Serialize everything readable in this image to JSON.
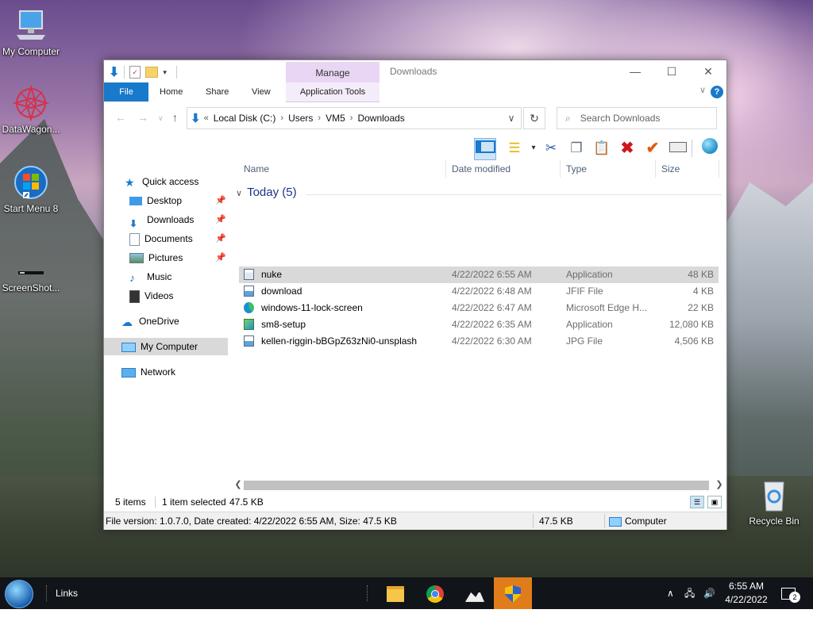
{
  "desktop": {
    "icons": [
      {
        "label": "My Computer",
        "icon": "computer-icon"
      },
      {
        "label": "DataWagon...",
        "icon": "datawagon-icon"
      },
      {
        "label": "Start Menu 8",
        "icon": "start-menu-icon"
      },
      {
        "label": "ScreenShot...",
        "icon": "screenshot-icon"
      },
      {
        "label": "Recycle Bin",
        "icon": "recycle-bin-icon"
      }
    ]
  },
  "window": {
    "title": "Downloads",
    "manage_label": "Manage",
    "controls": {
      "minimize": "—",
      "maximize": "☐",
      "close": "✕"
    },
    "ribbon_tabs": [
      "File",
      "Home",
      "Share",
      "View",
      "Application Tools"
    ],
    "help_glyph": "?",
    "address": {
      "prefix": "«",
      "segments": [
        "Local Disk (C:)",
        "Users",
        "VM5",
        "Downloads"
      ]
    },
    "search_placeholder": "Search Downloads",
    "nav_pane": {
      "quick_access": "Quick access",
      "pinned": [
        "Desktop",
        "Downloads",
        "Documents",
        "Pictures"
      ],
      "unpinned": [
        "Music",
        "Videos"
      ],
      "onedrive": "OneDrive",
      "my_computer": "My Computer",
      "network": "Network"
    },
    "columns": {
      "name": "Name",
      "date": "Date modified",
      "type": "Type",
      "size": "Size"
    },
    "group_label": "Today (5)",
    "files": [
      {
        "name": "nuke",
        "date": "4/22/2022 6:55 AM",
        "type": "Application",
        "size": "48 KB",
        "icon": "application-icon",
        "selected": true
      },
      {
        "name": "download",
        "date": "4/22/2022 6:48 AM",
        "type": "JFIF File",
        "size": "4 KB",
        "icon": "image-file-icon",
        "selected": false
      },
      {
        "name": "windows-11-lock-screen",
        "date": "4/22/2022 6:47 AM",
        "type": "Microsoft Edge H...",
        "size": "22 KB",
        "icon": "edge-icon",
        "selected": false
      },
      {
        "name": "sm8-setup",
        "date": "4/22/2022 6:35 AM",
        "type": "Application",
        "size": "12,080 KB",
        "icon": "setup-icon",
        "selected": false
      },
      {
        "name": "kellen-riggin-bBGpZ63zNi0-unsplash",
        "date": "4/22/2022 6:30 AM",
        "type": "JPG File",
        "size": "4,506 KB",
        "icon": "image-file-icon",
        "selected": false
      }
    ],
    "status": {
      "items_count": "5 items",
      "selection": "1 item selected",
      "selection_size": "47.5 KB"
    },
    "statusbar": {
      "info": "File version: 1.0.7.0, Date created: 4/22/2022 6:55 AM, Size: 47.5 KB",
      "size": "47.5 KB",
      "location": "Computer"
    }
  },
  "taskbar": {
    "links_label": "Links",
    "clock_time": "6:55 AM",
    "clock_date": "4/22/2022",
    "notification_count": "2"
  },
  "colors": {
    "accent": "#1979ca",
    "manage_tab": "#e9d6f5",
    "active_task": "#e07d1a"
  }
}
